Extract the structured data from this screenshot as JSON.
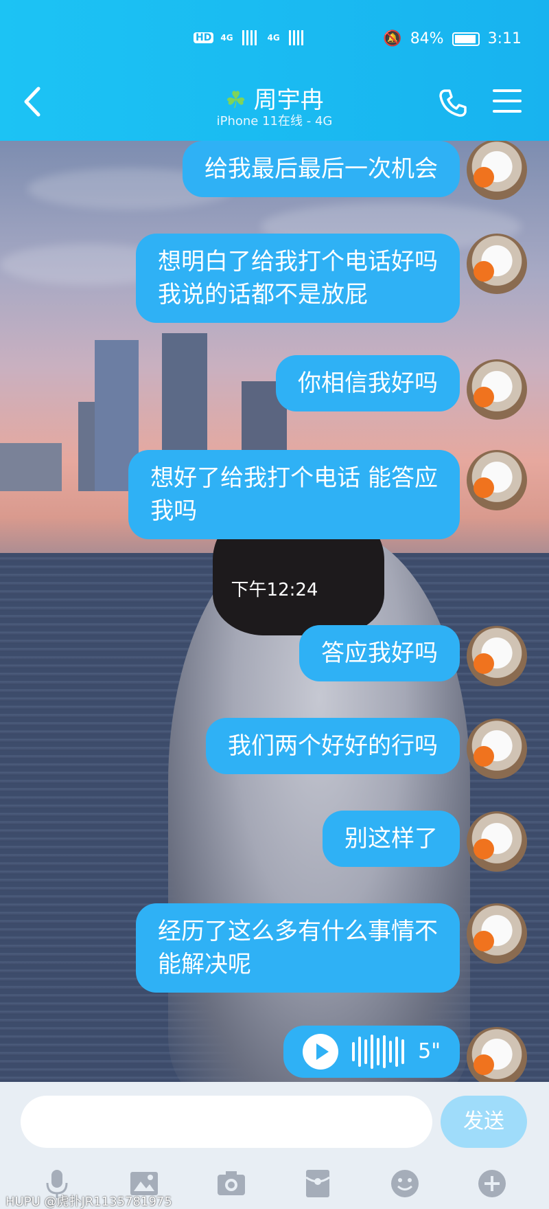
{
  "status_bar": {
    "hd": "HD",
    "net1": "4G",
    "net2": "4G",
    "battery": "84%",
    "time": "3:11"
  },
  "header": {
    "contact_name": "周宇冉",
    "status": "iPhone 11在线 - 4G"
  },
  "messages": [
    {
      "text": "给我最后最后一次机会"
    },
    {
      "text": "想明白了给我打个电话好吗\n我说的话都不是放屁"
    },
    {
      "text": "你相信我好吗"
    },
    {
      "text": "想好了给我打个电话 能答应\n我吗"
    },
    {
      "text": "答应我好吗"
    },
    {
      "text": "我们两个好好的行吗"
    },
    {
      "text": "别这样了"
    },
    {
      "text": "经历了这么多有什么事情不\n能解决呢"
    }
  ],
  "timestamp": "下午12:24",
  "voice_message": {
    "duration": "5\""
  },
  "input": {
    "placeholder": "",
    "send_label": "发送"
  },
  "watermark": "HUPU @虎扑JR1135781975",
  "colors": {
    "accent": "#18b3ef",
    "bubble": "#2fb1f5"
  },
  "icons": [
    "microphone-icon",
    "image-icon",
    "camera-icon",
    "red-packet-icon",
    "emoji-icon",
    "plus-icon"
  ]
}
